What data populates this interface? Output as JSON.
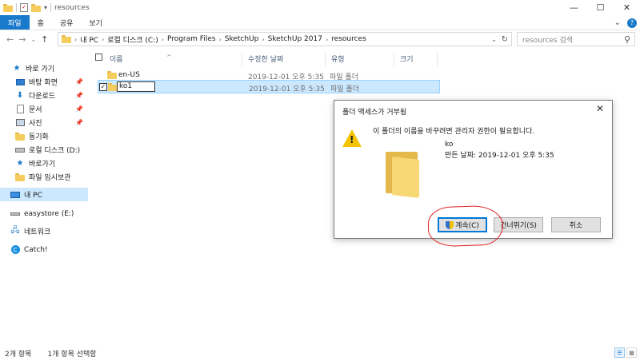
{
  "window": {
    "title": "resources",
    "controls": [
      "—",
      "☐",
      "✕"
    ]
  },
  "ribbon": {
    "tabs": [
      "파일",
      "홈",
      "공유",
      "보기"
    ]
  },
  "address": {
    "crumbs": [
      "내 PC",
      "로컬 디스크 (C:)",
      "Program Files",
      "SketchUp",
      "SketchUp 2017",
      "resources"
    ]
  },
  "search": {
    "placeholder": "resources 검색"
  },
  "sidebar": {
    "items": [
      {
        "label": "바로 가기",
        "icon": "star-icon"
      },
      {
        "label": "바탕 화면",
        "icon": "desktop-icon",
        "pinned": true
      },
      {
        "label": "다운로드",
        "icon": "download-icon",
        "pinned": true
      },
      {
        "label": "문서",
        "icon": "document-icon",
        "pinned": true
      },
      {
        "label": "사진",
        "icon": "pictures-icon",
        "pinned": true
      },
      {
        "label": "동기화",
        "icon": "folder-icon"
      },
      {
        "label": "로컬 디스크 (D:)",
        "icon": "drive-icon"
      },
      {
        "label": "바로가기",
        "icon": "star-folder-icon"
      },
      {
        "label": "파일 임시보관",
        "icon": "folder-icon"
      },
      {
        "label": "내 PC",
        "icon": "pc-icon"
      },
      {
        "label": "easystore (E:)",
        "icon": "drive-icon"
      },
      {
        "label": "네트워크",
        "icon": "network-icon"
      },
      {
        "label": "Catch!",
        "icon": "catch-icon"
      }
    ]
  },
  "columns": {
    "name": "이름",
    "date": "수정한 날짜",
    "type": "유형",
    "size": "크기"
  },
  "files": [
    {
      "name": "en-US",
      "date": "2019-12-01 오후 5:35",
      "type": "파일 폴더"
    },
    {
      "name": "ko1",
      "date": "2019-12-01 오후 5:35",
      "type": "파일 폴더"
    }
  ],
  "status": {
    "count": "2개 항목",
    "selected": "1개 항목 선택함"
  },
  "dialog": {
    "title": "폴더 액세스가 거부됨",
    "message": "이 폴더의 이름을 바꾸려면 관리자 권한이 필요합니다.",
    "folder_name": "ko",
    "created": "만든 날짜: 2019-12-01 오후 5:35",
    "buttons": {
      "continue": "계속(C)",
      "skip": "건너뛰기(S)",
      "cancel": "취소"
    }
  },
  "colors": {
    "accent": "#1979ca",
    "selection": "#cce8ff",
    "annotation": "#e02020"
  }
}
